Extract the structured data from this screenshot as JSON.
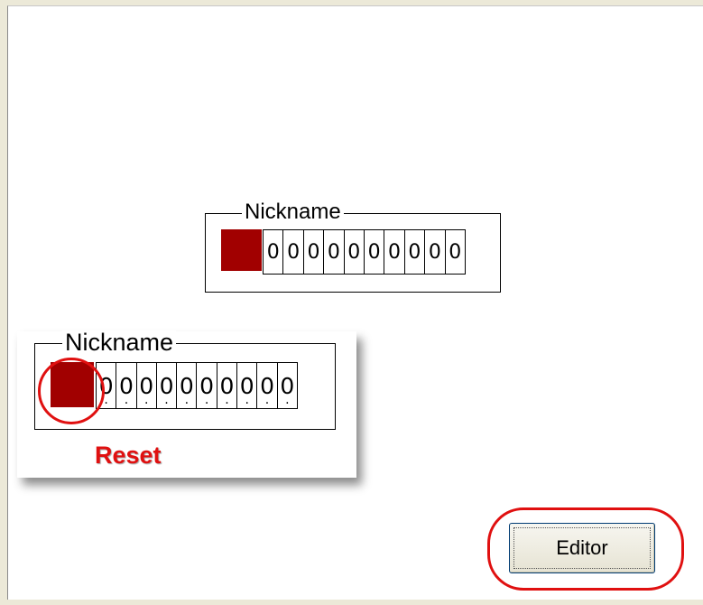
{
  "nickname_widget": {
    "legend": "Nickname",
    "digits": [
      "0",
      "0",
      "0",
      "0",
      "0",
      "0",
      "0",
      "0",
      "0",
      "0"
    ],
    "reset_color": "#a10000"
  },
  "zoom_callout": {
    "legend": "Nickname",
    "digits": [
      "0",
      "0",
      "0",
      "0",
      "0",
      "0",
      "0",
      "0",
      "0",
      "0"
    ],
    "reset_label": "Reset",
    "highlight_color": "#e01010"
  },
  "editor": {
    "button_label": "Editor"
  }
}
